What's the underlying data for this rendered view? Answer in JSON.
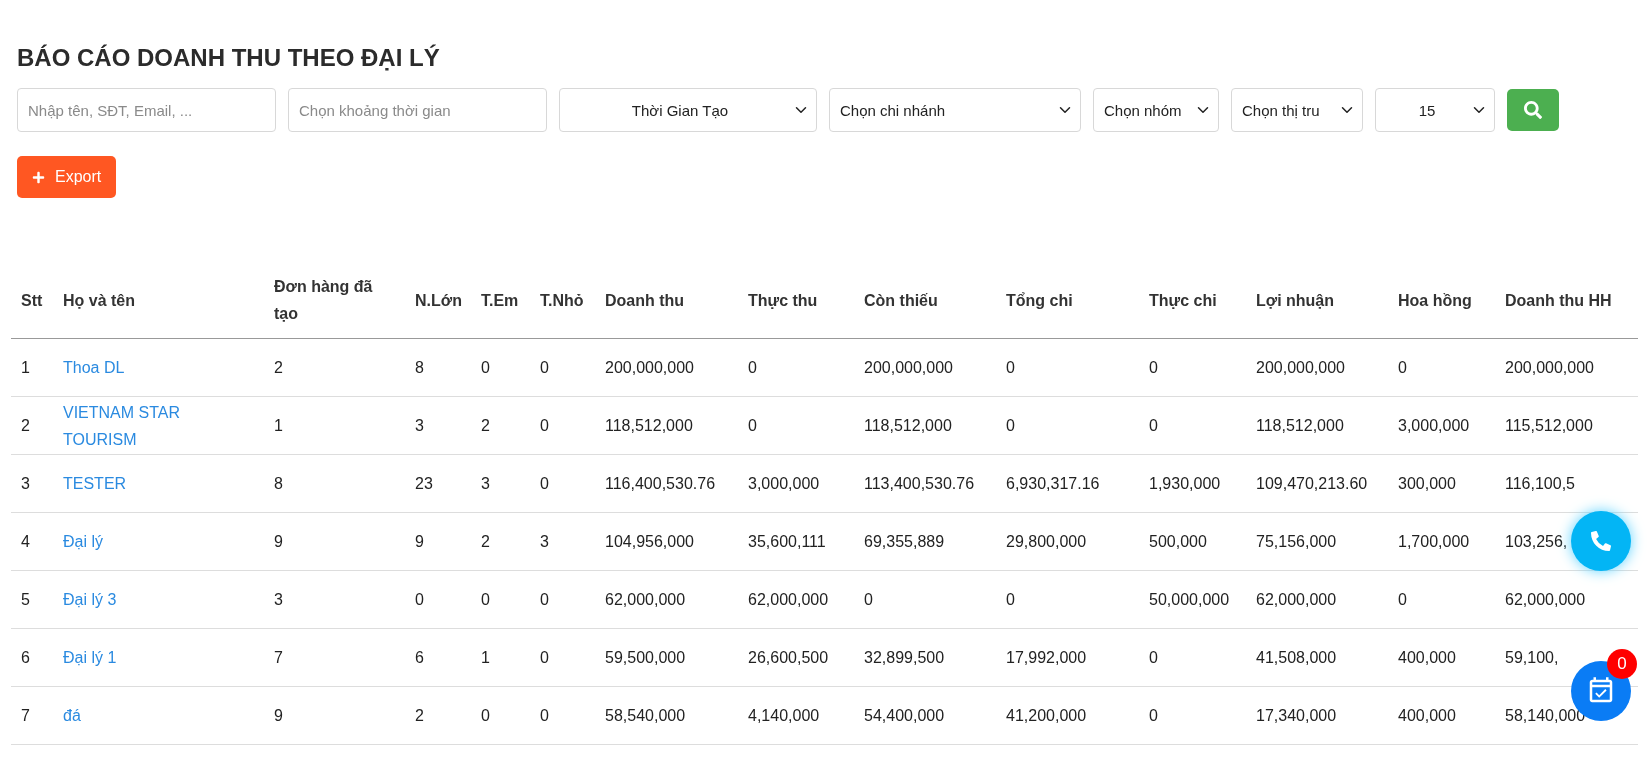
{
  "title": "BÁO CÁO DOANH THU THEO ĐẠI LÝ",
  "filters": [
    {
      "kind": "input",
      "placeholder": "Nhập tên, SĐT, Email, ..."
    },
    {
      "kind": "input",
      "placeholder": "Chọn khoảng thời gian"
    },
    {
      "kind": "centered_select",
      "value": "Thời Gian Tạo"
    },
    {
      "kind": "select",
      "value": "Chọn chi nhánh"
    },
    {
      "kind": "select",
      "value": "Chọn nhóm"
    },
    {
      "kind": "select",
      "value": "Chọn thị tru"
    },
    {
      "kind": "centered_select",
      "value": "15"
    }
  ],
  "export_button": "Export",
  "table": {
    "columns": [
      "Stt",
      "Họ và tên",
      "Đơn hàng đã tạo",
      "N.Lớn",
      "T.Em",
      "T.Nhỏ",
      "Doanh thu",
      "Thực thu",
      "Còn thiếu",
      "Tổng chi",
      "Thực chi",
      "Lợi nhuận",
      "Hoa hồng",
      "Doanh thu HH"
    ],
    "rows": [
      [
        "1",
        "Thoa DL",
        "2",
        "8",
        "0",
        "0",
        "200,000,000",
        "0",
        "200,000,000",
        "0",
        "0",
        "200,000,000",
        "0",
        "200,000,000"
      ],
      [
        "2",
        "VIETNAM STAR TOURISM",
        "1",
        "3",
        "2",
        "0",
        "118,512,000",
        "0",
        "118,512,000",
        "0",
        "0",
        "118,512,000",
        "3,000,000",
        "115,512,000"
      ],
      [
        "3",
        "TESTER",
        "8",
        "23",
        "3",
        "0",
        "116,400,530.76",
        "3,000,000",
        "113,400,530.76",
        "6,930,317.16",
        "1,930,000",
        "109,470,213.60",
        "300,000",
        "116,100,5"
      ],
      [
        "4",
        "Đại lý",
        "9",
        "9",
        "2",
        "3",
        "104,956,000",
        "35,600,111",
        "69,355,889",
        "29,800,000",
        "500,000",
        "75,156,000",
        "1,700,000",
        "103,256,"
      ],
      [
        "5",
        "Đại lý 3",
        "3",
        "0",
        "0",
        "0",
        "62,000,000",
        "62,000,000",
        "0",
        "0",
        "50,000,000",
        "62,000,000",
        "0",
        "62,000,000"
      ],
      [
        "6",
        "Đại lý 1",
        "7",
        "6",
        "1",
        "0",
        "59,500,000",
        "26,600,500",
        "32,899,500",
        "17,992,000",
        "0",
        "41,508,000",
        "400,000",
        "59,100,"
      ],
      [
        "7",
        "đá",
        "9",
        "2",
        "0",
        "0",
        "58,540,000",
        "4,140,000",
        "54,400,000",
        "41,200,000",
        "0",
        "17,340,000",
        "400,000",
        "58,140,000"
      ]
    ]
  },
  "task_badge": "0"
}
